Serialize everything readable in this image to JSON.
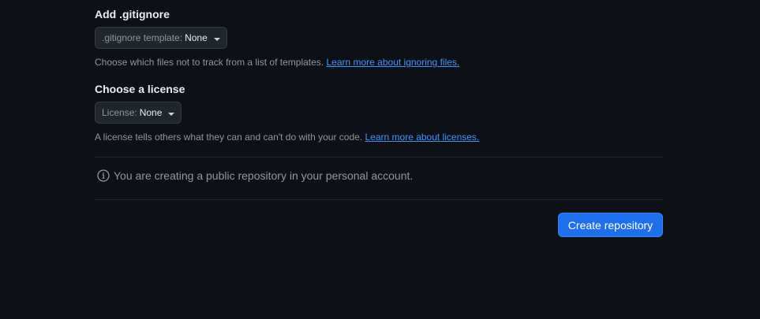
{
  "gitignore": {
    "title": "Add .gitignore",
    "select_prefix": ".gitignore template:",
    "select_value": "None",
    "note_text": "Choose which files not to track from a list of templates. ",
    "note_link": "Learn more about ignoring files."
  },
  "license": {
    "title": "Choose a license",
    "select_prefix": "License:",
    "select_value": "None",
    "note_text": "A license tells others what they can and can't do with your code. ",
    "note_link": "Learn more about licenses."
  },
  "info": {
    "icon": "info-icon",
    "text": "You are creating a public repository in your personal account."
  },
  "actions": {
    "create_label": "Create repository"
  },
  "colors": {
    "background": "#0d1117",
    "accent": "#1f6feb",
    "link": "#4493f8",
    "muted_text": "#8d96a0"
  }
}
